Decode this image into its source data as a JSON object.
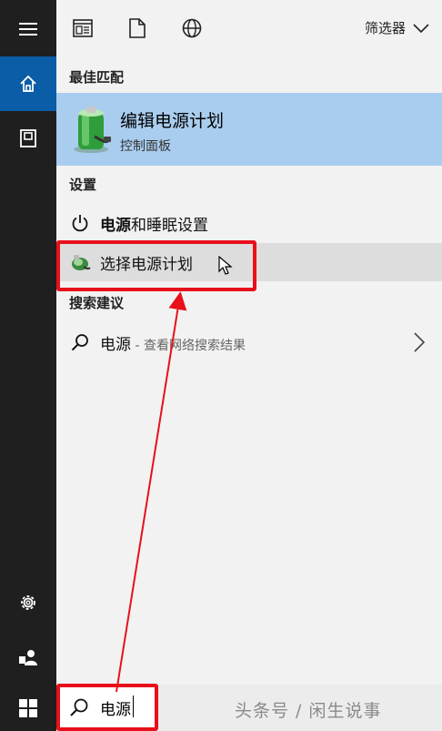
{
  "toolbar": {
    "filter_label": "筛选器"
  },
  "sections": {
    "best_match": "最佳匹配",
    "settings": "设置",
    "suggestions": "搜索建议"
  },
  "best_match": {
    "title": "编辑电源计划",
    "subtitle": "控制面板"
  },
  "settings_items": [
    {
      "bold": "电源",
      "rest": "和睡眠设置"
    },
    {
      "label": "选择电源计划"
    }
  ],
  "suggestion": {
    "term": "电源",
    "hint": " - 查看网络搜索结果"
  },
  "search": {
    "value": "电源"
  },
  "watermark": "头条号 / 闲生说事",
  "colors": {
    "rail": "#1f1f1f",
    "rail_active": "#0a5da6",
    "best_match_bg": "#a9cdef",
    "hover_bg": "#dddddd",
    "annotation_red": "#e8101b"
  },
  "icons": {
    "rail": [
      "hamburger-icon",
      "home-icon",
      "document-icon",
      "settings-gear-icon",
      "user-icon"
    ],
    "toolbar": [
      "apps-icon",
      "documents-icon",
      "web-globe-icon",
      "chevron-down-icon"
    ],
    "start": "windows-logo-icon"
  }
}
